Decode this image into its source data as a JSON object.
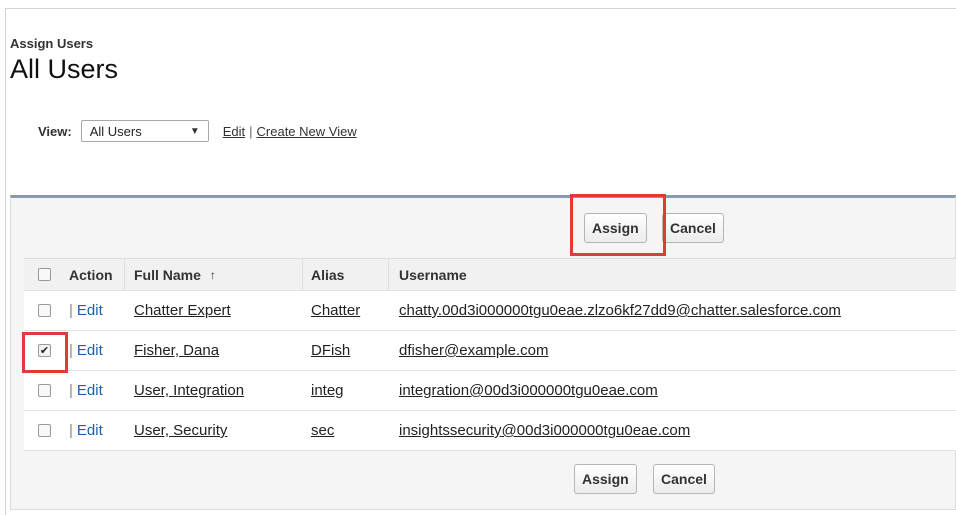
{
  "header": {
    "subtitle": "Assign Users",
    "title": "All Users"
  },
  "view": {
    "label": "View:",
    "selected": "All Users",
    "edit_label": "Edit",
    "separator": "|",
    "create_label": "Create New View"
  },
  "buttons": {
    "assign": "Assign",
    "cancel": "Cancel"
  },
  "table": {
    "columns": {
      "action": "Action",
      "full_name": "Full Name",
      "sort_arrow": "↑",
      "alias": "Alias",
      "username": "Username"
    },
    "action_separator": "|",
    "rows": [
      {
        "checked": false,
        "action": "Edit",
        "full_name": "Chatter Expert",
        "alias": "Chatter",
        "username": "chatty.00d3i000000tgu0eae.zlzo6kf27dd9@chatter.salesforce.com"
      },
      {
        "checked": true,
        "action": "Edit",
        "full_name": "Fisher, Dana",
        "alias": "DFish",
        "username": "dfisher@example.com"
      },
      {
        "checked": false,
        "action": "Edit",
        "full_name": "User, Integration",
        "alias": "integ",
        "username": "integration@00d3i000000tgu0eae.com"
      },
      {
        "checked": false,
        "action": "Edit",
        "full_name": "User, Security",
        "alias": "sec",
        "username": "insightssecurity@00d3i000000tgu0eae.com"
      }
    ]
  },
  "colors": {
    "highlight": "#e03a3a",
    "panel_border": "#8a9aae",
    "edit_link": "#1f5fa8"
  }
}
